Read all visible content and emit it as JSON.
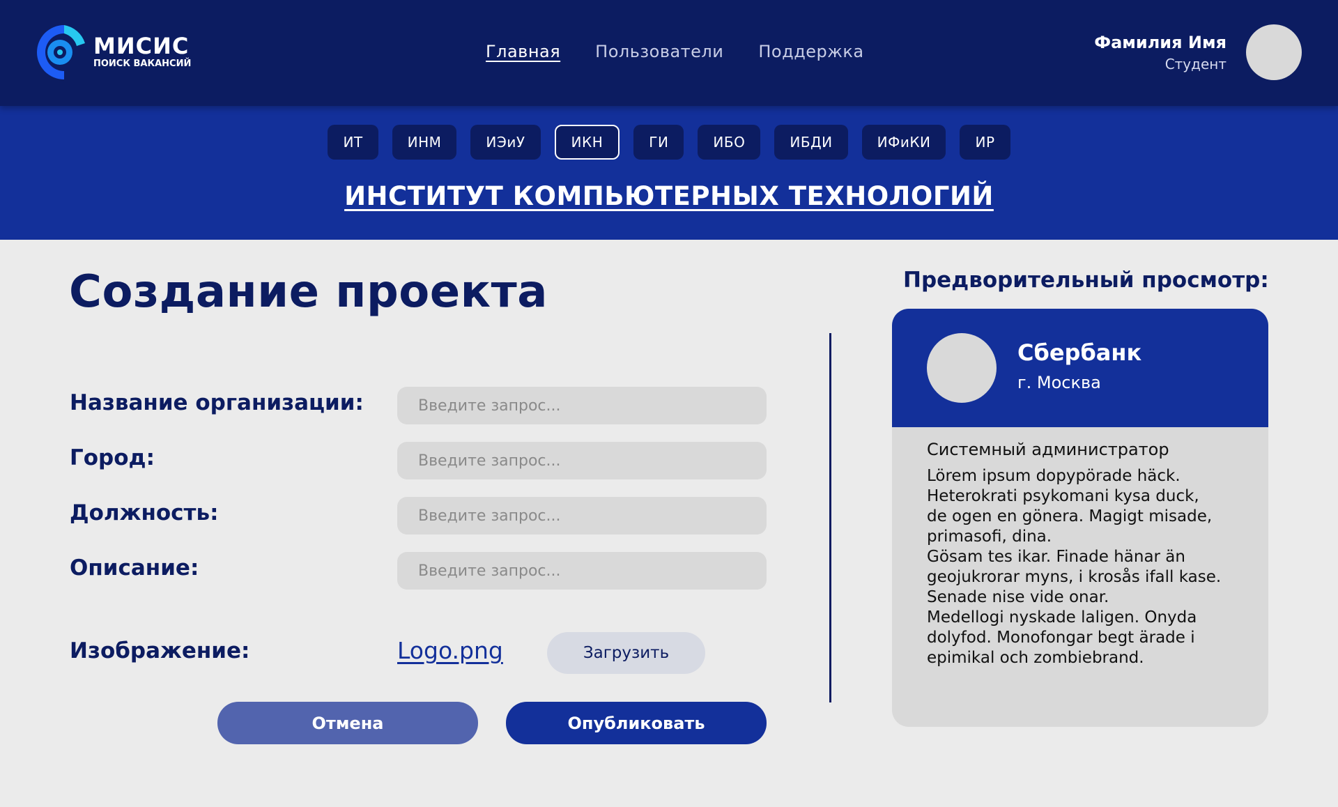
{
  "brand": {
    "title": "МИСИС",
    "subtitle": "ПОИСК ВАКАНСИЙ"
  },
  "nav": {
    "items": [
      "Главная",
      "Пользователи",
      "Поддержка"
    ],
    "active": "Главная"
  },
  "user": {
    "name": "Фамилия Имя",
    "role": "Студент"
  },
  "institutes": {
    "tabs": [
      "ИТ",
      "ИНМ",
      "ИЭиУ",
      "ИКН",
      "ГИ",
      "ИБО",
      "ИБДИ",
      "ИФиКИ",
      "ИР"
    ],
    "active": "ИКН",
    "title": "ИНСТИТУТ КОМПЬЮТЕРНЫХ ТЕХНОЛОГИЙ"
  },
  "form": {
    "title": "Создание проекта",
    "fields": [
      {
        "label": "Название организации:",
        "placeholder": "Введите запрос..."
      },
      {
        "label": "Город:",
        "placeholder": "Введите запрос..."
      },
      {
        "label": "Должность:",
        "placeholder": "Введите запрос..."
      },
      {
        "label": "Описание:",
        "placeholder": "Введите запрос..."
      }
    ],
    "image": {
      "label": "Изображение:",
      "file": "Logo.png",
      "upload_label": "Загрузить"
    },
    "cancel_label": "Отмена",
    "publish_label": "Опубликовать"
  },
  "preview": {
    "heading": "Предворительный просмотр:",
    "org": "Сбербанк",
    "city": "г. Москва",
    "position": "Системный администратор",
    "description": "Lörem ipsum dopypörade häck.\nHeterokrati psykomani kysa duck,\nde ogen en gönera. Magigt misade,\nprimasofi, dina.\nGösam tes ikar. Finade hänar än\ngeojukrorar myns, i krosås ifall kase.\nSenade nise vide onar.\nMedellogi nyskade laligen. Onyda\ndolyfod. Monofongar begt ärade i\nepimikal och zombiebrand."
  },
  "colors": {
    "header": "#0c1c61",
    "band": "#13309a",
    "accent": "#13309a",
    "cancel": "#5264ae",
    "background": "#ebebeb",
    "field": "#d9d9d9"
  }
}
